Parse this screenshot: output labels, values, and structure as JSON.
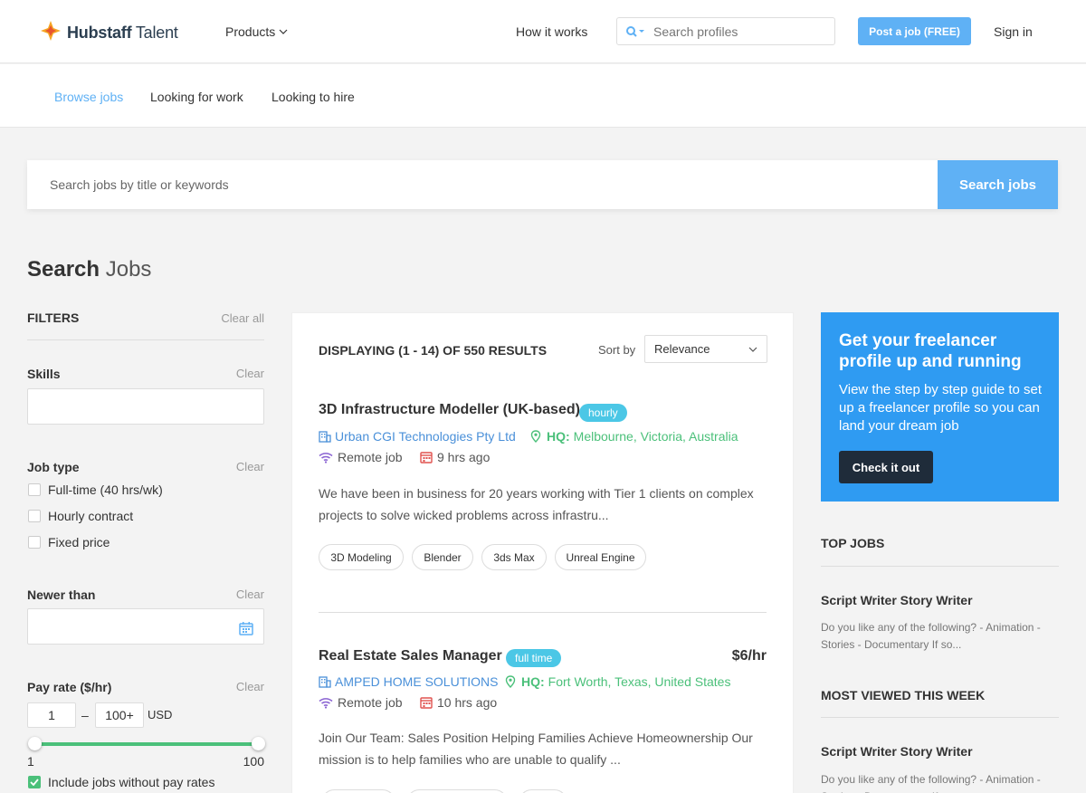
{
  "header": {
    "logo_text": "Hubstaff",
    "logo_text_thin": " Talent",
    "products_label": "Products",
    "how_it_works": "How it works",
    "search_placeholder": "Search profiles",
    "post_job_label": "Post a job (FREE)",
    "sign_in": "Sign in"
  },
  "subnav": {
    "browse_jobs": "Browse jobs",
    "looking_for_work": "Looking for work",
    "looking_to_hire": "Looking to hire"
  },
  "search": {
    "placeholder": "Search jobs by title or keywords",
    "button": "Search jobs"
  },
  "title": {
    "bold": "Search",
    "thin": "Jobs"
  },
  "filters": {
    "heading": "FILTERS",
    "clear_all": "Clear all",
    "skills": {
      "label": "Skills",
      "clear": "Clear"
    },
    "job_type": {
      "label": "Job type",
      "clear": "Clear",
      "options": [
        "Full-time (40 hrs/wk)",
        "Hourly contract",
        "Fixed price"
      ]
    },
    "newer_than": {
      "label": "Newer than",
      "clear": "Clear"
    },
    "pay_rate": {
      "label": "Pay rate ($/hr)",
      "clear": "Clear",
      "min": "1",
      "dash": "–",
      "max": "100+",
      "currency": "USD",
      "slider_min_label": "1",
      "slider_max_label": "100",
      "include_label": "Include jobs without pay rates"
    }
  },
  "results": {
    "count_text": "DISPLAYING (1 - 14) OF 550 RESULTS",
    "sort_label": "Sort by",
    "sort_value": "Relevance"
  },
  "jobs": [
    {
      "title": "3D Infrastructure Modeller (UK-based)",
      "type": "hourly",
      "rate": "",
      "company": "Urban CGI Technologies Pty Ltd",
      "hq_label": "HQ:",
      "location": "Melbourne, Victoria, Australia",
      "remote": "Remote job",
      "posted": "9 hrs ago",
      "desc_line1": "We have been in business for 20 years working with Tier 1 clients on complex",
      "desc_line2": "projects to solve wicked problems across infrastru...",
      "tags": [
        "3D Modeling",
        "Blender",
        "3ds Max",
        "Unreal Engine"
      ]
    },
    {
      "title": "Real Estate Sales Manager",
      "type": "full time",
      "rate": "$6/hr",
      "company": "AMPED HOME SOLUTIONS",
      "hq_label": "HQ:",
      "location": "Fort Worth, Texas, United States",
      "remote": "Remote job",
      "posted": "10 hrs ago",
      "desc_line1": "Join Our Team: Sales Position Helping Families Achieve Homeownership Our",
      "desc_line2": "mission is to help families who are unable to qualify ...",
      "tags": []
    }
  ],
  "promo": {
    "heading": "Get your freelancer profile up and running",
    "body": "View the step by step guide to set up a freelancer profile so you can land your dream job",
    "cta": "Check it out"
  },
  "sidebar": {
    "top_jobs_heading": "TOP JOBS",
    "top_job_title": "Script Writer Story Writer",
    "top_job_desc": "Do you like any of the following? - Animation - Stories - Documentary If so...",
    "most_viewed_heading": "MOST VIEWED THIS WEEK",
    "most_viewed_title": "Script Writer Story Writer",
    "most_viewed_desc": "Do you like any of the following? - Animation - Stories - Documentary If so..."
  },
  "colors": {
    "accent_blue": "#5fb1f5",
    "link_blue": "#4a90d9",
    "green": "#4bc07a",
    "pill_cyan": "#4bc7e6",
    "promo_blue": "#2f9bf2",
    "icon_purple": "#8a63d2",
    "icon_red": "#e0524f"
  }
}
